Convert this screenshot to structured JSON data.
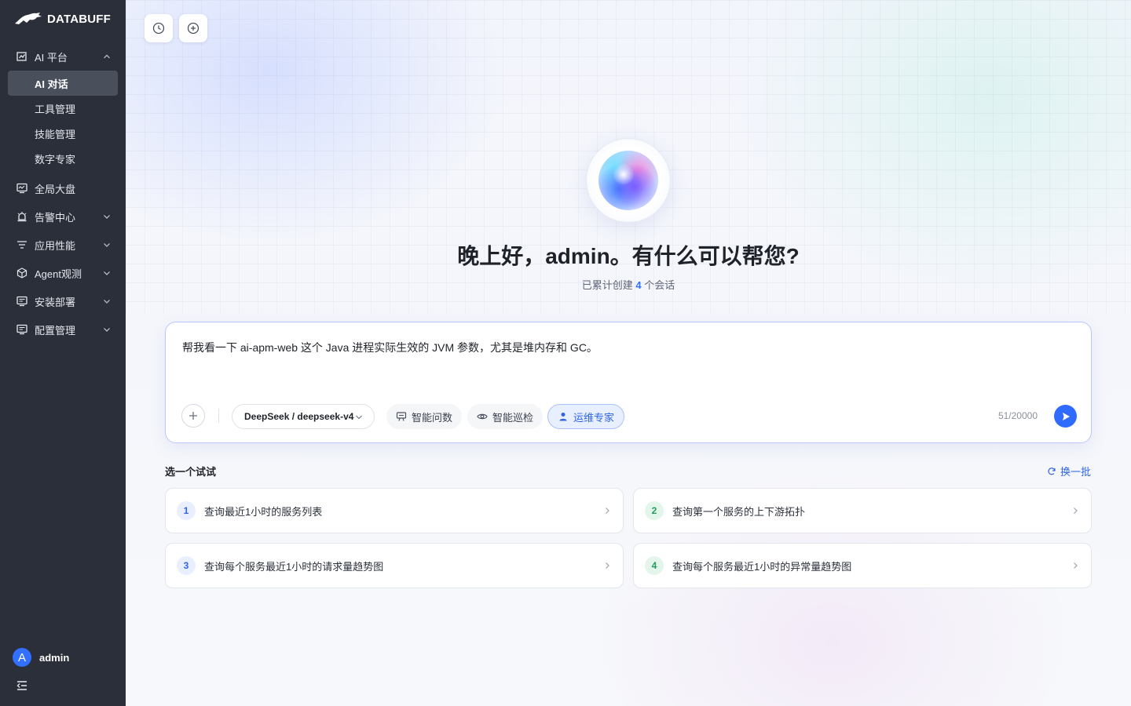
{
  "brand": {
    "name": "DATABUFF"
  },
  "sidebar": {
    "items": [
      {
        "label": "AI 平台",
        "icon": "ai-chart-icon",
        "expanded": true,
        "children": [
          {
            "label": "AI 对话",
            "active": true
          },
          {
            "label": "工具管理"
          },
          {
            "label": "技能管理"
          },
          {
            "label": "数字专家"
          }
        ]
      },
      {
        "label": "全局大盘",
        "icon": "dashboard-icon"
      },
      {
        "label": "告警中心",
        "icon": "alarm-icon",
        "expanded": false
      },
      {
        "label": "应用性能",
        "icon": "filter-list-icon",
        "expanded": false
      },
      {
        "label": "Agent观测",
        "icon": "cube-icon",
        "expanded": false
      },
      {
        "label": "安装部署",
        "icon": "install-icon",
        "expanded": false
      },
      {
        "label": "配置管理",
        "icon": "config-icon",
        "expanded": false
      }
    ],
    "user": {
      "avatar_letter": "A",
      "name": "admin"
    }
  },
  "main": {
    "greeting": "晚上好，admin。有什么可以帮您?",
    "stats": {
      "prefix": "已累计创建",
      "count": "4",
      "suffix": "个会话"
    },
    "composer": {
      "text": "帮我看一下 ai-apm-web 这个 Java 进程实际生效的 JVM 参数，尤其是堆内存和 GC。",
      "model": "DeepSeek / deepseek-v4",
      "chips": [
        {
          "label": "智能问数",
          "icon": "chart-board-icon",
          "active": false
        },
        {
          "label": "智能巡检",
          "icon": "eye-icon",
          "active": false
        },
        {
          "label": "运维专家",
          "icon": "user-icon",
          "active": true
        }
      ],
      "counter": "51/20000"
    },
    "suggestions": {
      "title": "选一个试试",
      "refresh_label": "换一批",
      "items": [
        {
          "num": "1",
          "text": "查询最近1小时的服务列表"
        },
        {
          "num": "2",
          "text": "查询第一个服务的上下游拓扑"
        },
        {
          "num": "3",
          "text": "查询每个服务最近1小时的请求量趋势图"
        },
        {
          "num": "4",
          "text": "查询每个服务最近1小时的异常量趋势图"
        }
      ]
    }
  },
  "colors": {
    "sidebar_bg": "#2b2f3a",
    "accent": "#2f6bff",
    "active_item": "#4a4f5c"
  }
}
